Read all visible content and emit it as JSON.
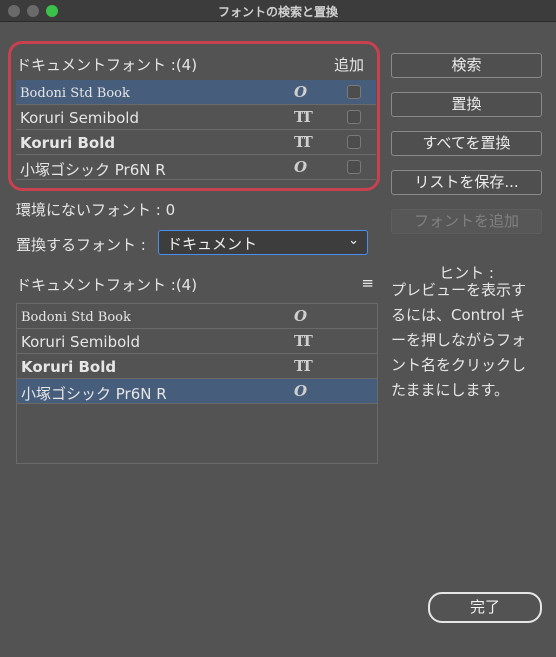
{
  "window": {
    "title": "フォントの検索と置換"
  },
  "top_list": {
    "title": "ドキュメントフォント :(4)",
    "add_label": "追加",
    "rows": [
      {
        "name": "Bodoni Std Book",
        "icon": "opentype-icon",
        "selected": true
      },
      {
        "name": "Koruri Semibold",
        "icon": "truetype-icon",
        "selected": false
      },
      {
        "name": "Koruri Bold",
        "icon": "truetype-icon",
        "selected": false
      },
      {
        "name": "小塚ゴシック Pr6N R",
        "icon": "opentype-icon",
        "selected": false
      }
    ]
  },
  "missing": {
    "label": "環境にないフォント : 0"
  },
  "replace": {
    "label": "置換するフォント :",
    "selected": "ドキュメント"
  },
  "doc_list": {
    "title": "ドキュメントフォント :(4)",
    "rows": [
      {
        "name": "Bodoni Std Book",
        "icon": "opentype-icon",
        "selected": false
      },
      {
        "name": "Koruri Semibold",
        "icon": "truetype-icon",
        "selected": false
      },
      {
        "name": "Koruri Bold",
        "icon": "truetype-icon",
        "selected": false
      },
      {
        "name": "小塚ゴシック Pr6N R",
        "icon": "opentype-icon",
        "selected": true
      }
    ]
  },
  "buttons": {
    "find": "検索",
    "change": "置換",
    "change_all": "すべてを置換",
    "save_list": "リストを保存...",
    "add_font": "フォントを追加",
    "done": "完了"
  },
  "hint": {
    "title": "ヒント :",
    "body_lines": [
      "プレビューを表示す",
      "るには、Control キ",
      "ーを押しながらフォ",
      "ント名をクリックし",
      "たままにします。"
    ]
  },
  "colors": {
    "accent": "#465d7c",
    "highlight_border": "#c8414f",
    "traffic_green": "#3ac24a"
  }
}
